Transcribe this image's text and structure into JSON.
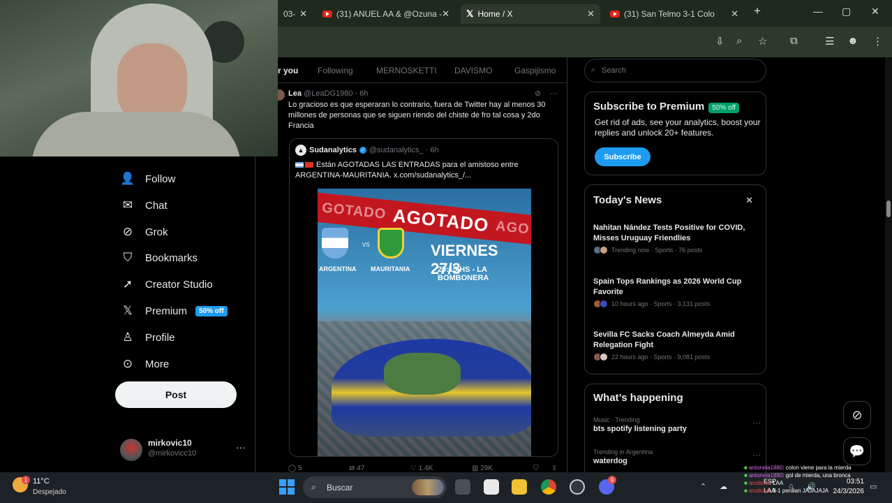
{
  "browser": {
    "tabs": [
      {
        "label": "03-"
      },
      {
        "label": "(31) ANUEL AA & @Ozuna -"
      },
      {
        "label": "Home / X"
      },
      {
        "label": "(31) San Telmo 3-1 Colo"
      }
    ],
    "new_tab": "+",
    "win_min": "—",
    "win_max": "▢",
    "win_close": "✕"
  },
  "nav": {
    "items": [
      {
        "label": "Follow",
        "icon": "person-plus-icon"
      },
      {
        "label": "Chat",
        "icon": "mail-icon"
      },
      {
        "label": "Grok",
        "icon": "grok-icon"
      },
      {
        "label": "Bookmarks",
        "icon": "bookmark-icon"
      },
      {
        "label": "Creator Studio",
        "icon": "rocket-icon"
      },
      {
        "label": "Premium",
        "icon": "x-logo-icon"
      },
      {
        "label": "Profile",
        "icon": "person-icon"
      },
      {
        "label": "More",
        "icon": "more-circle-icon"
      }
    ],
    "premium_badge": "50% off",
    "post_label": "Post",
    "account": {
      "name": "mirkovic10",
      "handle": "@mirkovicc10"
    }
  },
  "feed": {
    "tabs": [
      "r you",
      "Following",
      "MERNOSKETTI",
      "DAVISMO",
      "Gaspijismo"
    ],
    "tweet": {
      "name": "Lea",
      "handle_time": "@LeaDG1980 · 6h",
      "text": "Lo gracioso es que esperaran lo contrario, fuera de Twitter hay al menos 30 millones de personas que se siguen riendo del chiste de fro tal cosa y 2do Francia",
      "quote": {
        "name": "Sudanalytics",
        "handle_time": "@sudanalytics_ · 6h",
        "text": "Están AGOTADAS LAS ENTRADAS para el amistoso entre ARGENTINA-MAURITANIA.  x.com/sudanalytics_/...",
        "poster": {
          "banner": "AGOTADO",
          "banner_left": "GOTADO",
          "banner_right": "AGO",
          "vs": "VS",
          "team1": "ARGENTINA",
          "team2": "MAURITANIA",
          "date": "VIERNES 27/3",
          "time": "20:15 HS - LA BOMBONERA"
        }
      },
      "stats": {
        "replies": "5",
        "retweets": "47",
        "likes": "1.4K",
        "views": "29K"
      }
    }
  },
  "right": {
    "search_placeholder": "Search",
    "premium": {
      "title": "Subscribe to Premium",
      "badge": "50% off",
      "text": "Get rid of ads, see your analytics, boost your replies and unlock 20+ features.",
      "button": "Subscribe"
    },
    "news": {
      "title": "Today's News",
      "close": "✕",
      "items": [
        {
          "title": "Nahitan Nández Tests Positive for COVID, Misses Uruguay Friendlies",
          "meta": "Trending now · Sports · 76 posts"
        },
        {
          "title": "Spain Tops Rankings as 2026 World Cup Favorite",
          "meta": "10 hours ago · Sports · 3,131 posts"
        },
        {
          "title": "Sevilla FC Sacks Coach Almeyda Amid Relegation Fight",
          "meta": "22 hours ago · Sports · 9,081 posts"
        }
      ]
    },
    "happening": {
      "title": "What’s happening",
      "items": [
        {
          "meta": "Music · Trending",
          "topic": "bts spotify listening party"
        },
        {
          "meta": "Trending in Argentina",
          "topic": "waterdog"
        }
      ]
    }
  },
  "chat": [
    {
      "user": "antonela1880",
      "text": ": colon viene para la mierda"
    },
    {
      "user": "antonela1880",
      "text": ": gol de mierda, una bronca"
    },
    {
      "user": "ocuticha",
      "text": ": LAA"
    },
    {
      "user": "ocuticha",
      "text": ": 3-1 perdian JAJAJAJA"
    }
  ],
  "taskbar": {
    "weather_badge": "1",
    "temp": "11°C",
    "condition": "Despejado",
    "search_label": "Buscar",
    "discord_badge": "9",
    "lang_top": "ESP",
    "lang_bottom": "LAA",
    "time": "03:51",
    "date": "24/3/2026",
    "colors": {
      "windows": "#3aa0ff",
      "chrome": "#db4437",
      "discord": "#5865f2"
    }
  },
  "colors": {
    "accent": "#1d9bf0",
    "premium_badge": "#00a06a",
    "background": "#000000"
  }
}
